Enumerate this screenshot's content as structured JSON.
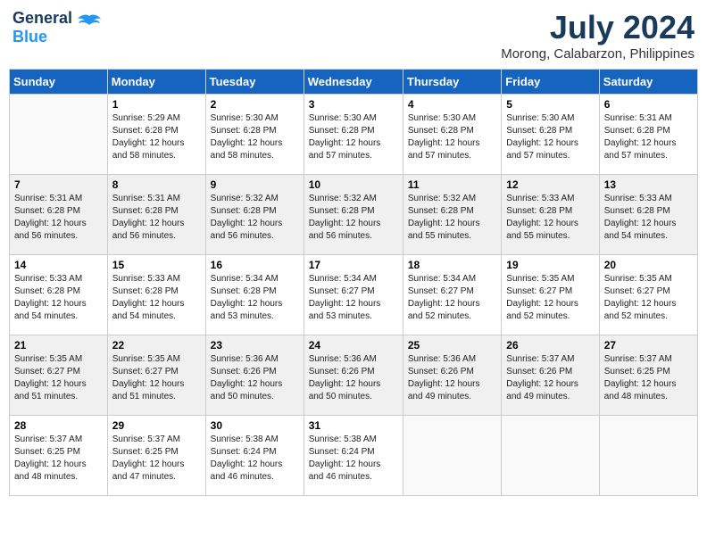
{
  "header": {
    "logo_general": "General",
    "logo_blue": "Blue",
    "month_year": "July 2024",
    "location": "Morong, Calabarzon, Philippines"
  },
  "calendar": {
    "days_of_week": [
      "Sunday",
      "Monday",
      "Tuesday",
      "Wednesday",
      "Thursday",
      "Friday",
      "Saturday"
    ],
    "weeks": [
      {
        "shaded": false,
        "days": [
          {
            "number": "",
            "info": ""
          },
          {
            "number": "1",
            "info": "Sunrise: 5:29 AM\nSunset: 6:28 PM\nDaylight: 12 hours\nand 58 minutes."
          },
          {
            "number": "2",
            "info": "Sunrise: 5:30 AM\nSunset: 6:28 PM\nDaylight: 12 hours\nand 58 minutes."
          },
          {
            "number": "3",
            "info": "Sunrise: 5:30 AM\nSunset: 6:28 PM\nDaylight: 12 hours\nand 57 minutes."
          },
          {
            "number": "4",
            "info": "Sunrise: 5:30 AM\nSunset: 6:28 PM\nDaylight: 12 hours\nand 57 minutes."
          },
          {
            "number": "5",
            "info": "Sunrise: 5:30 AM\nSunset: 6:28 PM\nDaylight: 12 hours\nand 57 minutes."
          },
          {
            "number": "6",
            "info": "Sunrise: 5:31 AM\nSunset: 6:28 PM\nDaylight: 12 hours\nand 57 minutes."
          }
        ]
      },
      {
        "shaded": true,
        "days": [
          {
            "number": "7",
            "info": "Sunrise: 5:31 AM\nSunset: 6:28 PM\nDaylight: 12 hours\nand 56 minutes."
          },
          {
            "number": "8",
            "info": "Sunrise: 5:31 AM\nSunset: 6:28 PM\nDaylight: 12 hours\nand 56 minutes."
          },
          {
            "number": "9",
            "info": "Sunrise: 5:32 AM\nSunset: 6:28 PM\nDaylight: 12 hours\nand 56 minutes."
          },
          {
            "number": "10",
            "info": "Sunrise: 5:32 AM\nSunset: 6:28 PM\nDaylight: 12 hours\nand 56 minutes."
          },
          {
            "number": "11",
            "info": "Sunrise: 5:32 AM\nSunset: 6:28 PM\nDaylight: 12 hours\nand 55 minutes."
          },
          {
            "number": "12",
            "info": "Sunrise: 5:33 AM\nSunset: 6:28 PM\nDaylight: 12 hours\nand 55 minutes."
          },
          {
            "number": "13",
            "info": "Sunrise: 5:33 AM\nSunset: 6:28 PM\nDaylight: 12 hours\nand 54 minutes."
          }
        ]
      },
      {
        "shaded": false,
        "days": [
          {
            "number": "14",
            "info": "Sunrise: 5:33 AM\nSunset: 6:28 PM\nDaylight: 12 hours\nand 54 minutes."
          },
          {
            "number": "15",
            "info": "Sunrise: 5:33 AM\nSunset: 6:28 PM\nDaylight: 12 hours\nand 54 minutes."
          },
          {
            "number": "16",
            "info": "Sunrise: 5:34 AM\nSunset: 6:28 PM\nDaylight: 12 hours\nand 53 minutes."
          },
          {
            "number": "17",
            "info": "Sunrise: 5:34 AM\nSunset: 6:27 PM\nDaylight: 12 hours\nand 53 minutes."
          },
          {
            "number": "18",
            "info": "Sunrise: 5:34 AM\nSunset: 6:27 PM\nDaylight: 12 hours\nand 52 minutes."
          },
          {
            "number": "19",
            "info": "Sunrise: 5:35 AM\nSunset: 6:27 PM\nDaylight: 12 hours\nand 52 minutes."
          },
          {
            "number": "20",
            "info": "Sunrise: 5:35 AM\nSunset: 6:27 PM\nDaylight: 12 hours\nand 52 minutes."
          }
        ]
      },
      {
        "shaded": true,
        "days": [
          {
            "number": "21",
            "info": "Sunrise: 5:35 AM\nSunset: 6:27 PM\nDaylight: 12 hours\nand 51 minutes."
          },
          {
            "number": "22",
            "info": "Sunrise: 5:35 AM\nSunset: 6:27 PM\nDaylight: 12 hours\nand 51 minutes."
          },
          {
            "number": "23",
            "info": "Sunrise: 5:36 AM\nSunset: 6:26 PM\nDaylight: 12 hours\nand 50 minutes."
          },
          {
            "number": "24",
            "info": "Sunrise: 5:36 AM\nSunset: 6:26 PM\nDaylight: 12 hours\nand 50 minutes."
          },
          {
            "number": "25",
            "info": "Sunrise: 5:36 AM\nSunset: 6:26 PM\nDaylight: 12 hours\nand 49 minutes."
          },
          {
            "number": "26",
            "info": "Sunrise: 5:37 AM\nSunset: 6:26 PM\nDaylight: 12 hours\nand 49 minutes."
          },
          {
            "number": "27",
            "info": "Sunrise: 5:37 AM\nSunset: 6:25 PM\nDaylight: 12 hours\nand 48 minutes."
          }
        ]
      },
      {
        "shaded": false,
        "days": [
          {
            "number": "28",
            "info": "Sunrise: 5:37 AM\nSunset: 6:25 PM\nDaylight: 12 hours\nand 48 minutes."
          },
          {
            "number": "29",
            "info": "Sunrise: 5:37 AM\nSunset: 6:25 PM\nDaylight: 12 hours\nand 47 minutes."
          },
          {
            "number": "30",
            "info": "Sunrise: 5:38 AM\nSunset: 6:24 PM\nDaylight: 12 hours\nand 46 minutes."
          },
          {
            "number": "31",
            "info": "Sunrise: 5:38 AM\nSunset: 6:24 PM\nDaylight: 12 hours\nand 46 minutes."
          },
          {
            "number": "",
            "info": ""
          },
          {
            "number": "",
            "info": ""
          },
          {
            "number": "",
            "info": ""
          }
        ]
      }
    ]
  }
}
